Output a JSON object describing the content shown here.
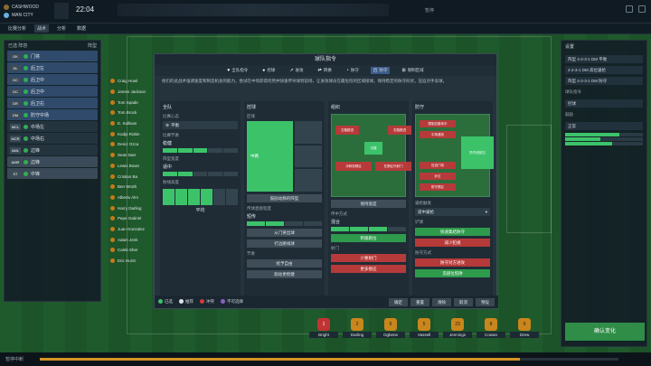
{
  "topbar": {
    "home_team": "CASHWOOD",
    "away_team": "MAN CITY",
    "clock": "22:04",
    "controls": "暂停"
  },
  "tabs": [
    "比赛分析",
    "战术",
    "分析",
    "数据"
  ],
  "left_panel": {
    "header": "已选 阵容",
    "filter": "阵型",
    "players": [
      {
        "pos": "GK",
        "name": "门将"
      },
      {
        "pos": "DL",
        "name": "后卫左"
      },
      {
        "pos": "DC",
        "name": "后卫中"
      },
      {
        "pos": "DC",
        "name": "后卫中"
      },
      {
        "pos": "DR",
        "name": "后卫右"
      },
      {
        "pos": "DM",
        "name": "防守中场"
      },
      {
        "pos": "MCL",
        "name": "中场左"
      },
      {
        "pos": "MCR",
        "name": "中场右"
      },
      {
        "pos": "AML",
        "name": "边锋"
      },
      {
        "pos": "AMR",
        "name": "边锋"
      },
      {
        "pos": "ST",
        "name": "中锋"
      }
    ]
  },
  "player_names": [
    "Craig Howl",
    "James Jackson",
    "Tom Spade",
    "Tom Brock",
    "E. Sullivan",
    "Kodjo Robin",
    "Deniz Ozca",
    "Sean Darr",
    "Lewis Bown",
    "Cristian Ba",
    "Ben Wroth",
    "Alberto Alm",
    "Harry Darling",
    "Pepe Gabriel",
    "Juan Gonzalez",
    "Adam Jenk",
    "Caleb Sher",
    "Eric Hurst"
  ],
  "modal": {
    "title": "球队指令",
    "icon_tabs": [
      {
        "glyph": "♥",
        "label": "全队指令",
        "active": false
      },
      {
        "glyph": "●",
        "label": "控球",
        "active": false
      },
      {
        "glyph": "↗",
        "label": "进攻",
        "active": false
      },
      {
        "glyph": "⇄",
        "label": "转换",
        "active": false
      },
      {
        "glyph": "◔",
        "label": "防守",
        "active": false
      },
      {
        "glyph": "◰",
        "label": "防守",
        "active": true
      },
      {
        "glyph": "⊞",
        "label": "限制区域",
        "active": false
      }
    ],
    "description": "他们的此战术强调速度和制造机会的能力，尝试在中场获得优势并快速传导球到前场，让进攻球员在最危险的区域接球。保持稳定的防守形状，压迫对手丢球。",
    "col_general": {
      "title": "全队",
      "mentality_label": "比赛心态",
      "mentality_value": "平衡",
      "tempo_label": "比赛节奏",
      "tempo_value": "稳健",
      "width_label": "阵型宽度",
      "width_value": "适中",
      "line_label": "防线高度",
      "line_value": "平均"
    },
    "col_possession": {
      "title": "控球",
      "area_label": "区域",
      "area_value": "中路",
      "btn1": "鼓励动静的阵型",
      "pass_label": "传球直接程度",
      "pass_value": "短传",
      "btn2": "从门将出球",
      "btn3": "打边路线球",
      "other_label": "节奏",
      "btn4": "给予自由",
      "btn5": "跑动更稳健"
    },
    "col_attack": {
      "title": "组织",
      "zones": [
        "左路推进",
        "中路",
        "右路推进",
        "冲刺到禁区",
        "在禁区外射门"
      ],
      "btn1": "保持宽度",
      "cross_label": "传中方式",
      "cross_value": "混合",
      "btn2": "积极跑位",
      "shoot_label": "射门",
      "btn3": "少要射门",
      "btn4": "更多接应"
    },
    "col_defence": {
      "title": "防守",
      "zones": [
        "限制边路传中",
        "中场逼抢",
        "防守线前压",
        "压迫门将",
        "补位",
        "防守禁区"
      ],
      "trigger_label": "逼抢触发",
      "trigger_value": "适中逼抢",
      "tackle_label": "铲球",
      "btn1": "快速集结防守",
      "btn2": "减少犯规",
      "press_label": "防守方式",
      "btn3": "防守对方进攻",
      "btn4": "造越位陷阱"
    },
    "legend": [
      {
        "label": "已选",
        "color": "#3cc36a"
      },
      {
        "label": "推荐",
        "color": "#e0e5e9"
      },
      {
        "label": "冲突",
        "color": "#d13b3b"
      },
      {
        "label": "不可选择",
        "color": "#8a5fc6"
      }
    ],
    "footer_buttons": [
      "确定",
      "重置",
      "清除",
      "取消",
      "预设"
    ]
  },
  "right_panel": {
    "title": "设置",
    "selects": [
      "阵型 4-2-3-1 DM 平衡",
      "4-2-3-1 DM 高位逼抢",
      "阵型 4-2-3-1 DM 防守"
    ],
    "label1": "球队指令",
    "select_role": "控球",
    "label2": "鼓励",
    "select_mode": "正常",
    "bars": [
      0.7,
      0.45,
      0.6
    ],
    "confirm": "确认变化"
  },
  "bottom_players": [
    {
      "num": "1",
      "name": "Bright",
      "red": true
    },
    {
      "num": "2",
      "name": "Darling",
      "red": false
    },
    {
      "num": "6",
      "name": "Ogbene",
      "red": false
    },
    {
      "num": "5",
      "name": "Vassell",
      "red": false
    },
    {
      "num": "23",
      "name": "Jennings",
      "red": false
    },
    {
      "num": "8",
      "name": "Cowan",
      "red": false
    },
    {
      "num": "9",
      "name": "Drew",
      "red": false
    }
  ],
  "status": {
    "text": "暂停中断",
    "progress": 0.83
  }
}
